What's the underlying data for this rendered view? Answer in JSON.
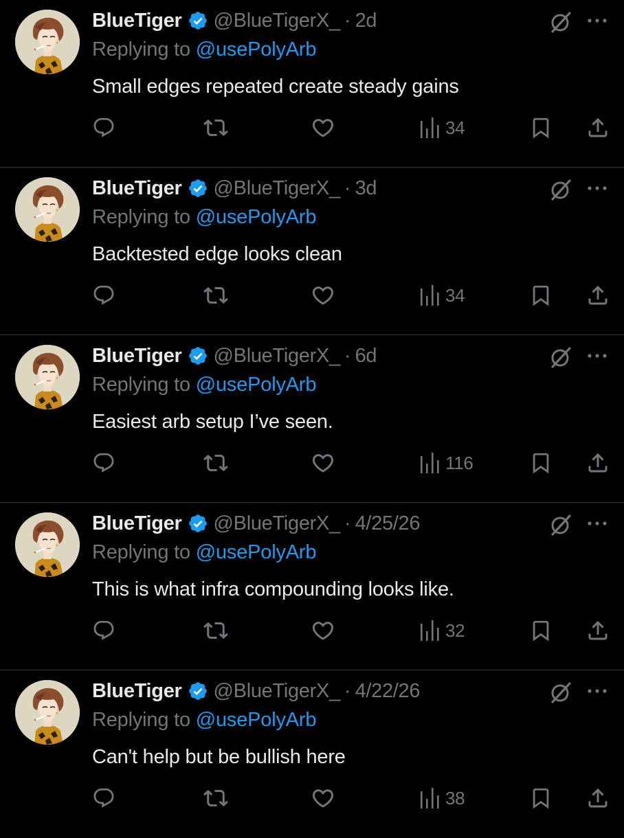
{
  "colors": {
    "background": "#000000",
    "text_primary": "#e7e9ea",
    "text_secondary": "#71767b",
    "link": "#1d9bf0",
    "verified": "#1d9bf0",
    "divider": "#2f3336"
  },
  "icons": {
    "reply": "speech-bubble-icon",
    "retweet": "repost-arrows-icon",
    "like": "heart-icon",
    "views": "bar-chart-icon",
    "bookmark": "bookmark-icon",
    "share": "share-upload-icon",
    "grok": "grok-slash-icon",
    "more": "more-dots-icon",
    "verified": "verified-badge-icon"
  },
  "tweets": [
    {
      "name": "BlueTiger",
      "handle": "@BlueTigerX_",
      "dot": "·",
      "time": "2d",
      "replying_prefix": "Replying to ",
      "replying_to": "@usePolyArb",
      "text": "Small edges repeated create steady gains",
      "views": "34"
    },
    {
      "name": "BlueTiger",
      "handle": "@BlueTigerX_",
      "dot": "·",
      "time": "3d",
      "replying_prefix": "Replying to ",
      "replying_to": "@usePolyArb",
      "text": "Backtested edge looks clean",
      "views": "34"
    },
    {
      "name": "BlueTiger",
      "handle": "@BlueTigerX_",
      "dot": "·",
      "time": "6d",
      "replying_prefix": "Replying to ",
      "replying_to": "@usePolyArb",
      "text": "Easiest arb setup I’ve seen.",
      "views": "116"
    },
    {
      "name": "BlueTiger",
      "handle": "@BlueTigerX_",
      "dot": "·",
      "time": "4/25/26",
      "replying_prefix": "Replying to ",
      "replying_to": "@usePolyArb",
      "text": "This is what infra compounding looks like.",
      "views": "32"
    },
    {
      "name": "BlueTiger",
      "handle": "@BlueTigerX_",
      "dot": "·",
      "time": "4/22/26",
      "replying_prefix": "Replying to ",
      "replying_to": "@usePolyArb",
      "text": "Can't help but be bullish here",
      "views": "38"
    }
  ]
}
